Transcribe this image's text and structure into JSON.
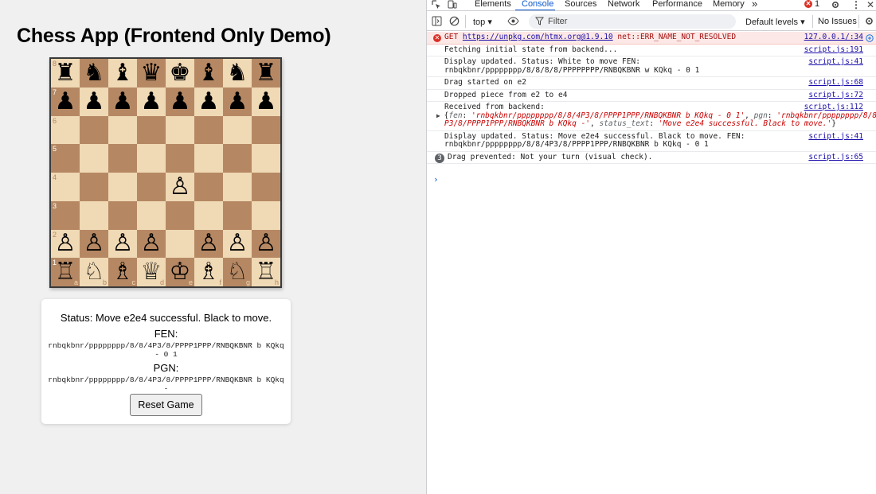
{
  "app": {
    "title": "Chess App (Frontend Only Demo)",
    "board": {
      "ranks": [
        "8",
        "7",
        "6",
        "5",
        "4",
        "3",
        "2",
        "1"
      ],
      "files": [
        "a",
        "b",
        "c",
        "d",
        "e",
        "f",
        "g",
        "h"
      ],
      "rows": [
        [
          "♜",
          "♞",
          "♝",
          "♛",
          "♚",
          "♝",
          "♞",
          "♜"
        ],
        [
          "♟",
          "♟",
          "♟",
          "♟",
          "♟",
          "♟",
          "♟",
          "♟"
        ],
        [
          "",
          "",
          "",
          "",
          "",
          "",
          "",
          ""
        ],
        [
          "",
          "",
          "",
          "",
          "",
          "",
          "",
          ""
        ],
        [
          "",
          "",
          "",
          "",
          "♙",
          "",
          "",
          ""
        ],
        [
          "",
          "",
          "",
          "",
          "",
          "",
          "",
          ""
        ],
        [
          "♙",
          "♙",
          "♙",
          "♙",
          "",
          "♙",
          "♙",
          "♙"
        ],
        [
          "♖",
          "♘",
          "♗",
          "♕",
          "♔",
          "♗",
          "♘",
          "♖"
        ]
      ]
    },
    "info": {
      "status": "Status: Move e2e4 successful. Black to move.",
      "fen_label": "FEN:",
      "fen_value": "rnbqkbnr/pppppppp/8/8/4P3/8/PPPP1PPP/RNBQKBNR b KQkq - 0 1",
      "pgn_label": "PGN:",
      "pgn_value": "rnbqkbnr/pppppppp/8/8/4P3/8/PPPP1PPP/RNBQKBNR b KQkq -",
      "reset_label": "Reset Game"
    }
  },
  "devtools": {
    "tabs": [
      "Elements",
      "Console",
      "Sources",
      "Network",
      "Performance",
      "Memory"
    ],
    "active_tab": "Console",
    "more_tabs": "»",
    "error_count": "1",
    "toolbar": {
      "context": "top ▾",
      "filter_placeholder": "Filter",
      "levels": "Default levels ▾",
      "issues": "No Issues"
    },
    "messages": [
      {
        "type": "error",
        "text": "GET ",
        "link": "https://unpkg.com/htmx.org@1.9.10",
        "after": " net::ERR_NAME_NOT_RESOLVED",
        "source": "127.0.0.1/:34"
      },
      {
        "type": "log",
        "text": "Fetching initial state from backend...",
        "source": "script.js:191"
      },
      {
        "type": "log",
        "text": "Display updated. Status: White to move FEN:\nrnbqkbnr/pppppppp/8/8/8/8/PPPPPPPP/RNBQKBNR w KQkq - 0 1",
        "source": "script.js:41"
      },
      {
        "type": "log",
        "text": "Drag started on e2",
        "source": "script.js:68"
      },
      {
        "type": "log",
        "text": "Dropped piece from e2 to e4",
        "source": "script.js:72"
      },
      {
        "type": "object",
        "text": "Received from backend:",
        "source": "script.js:112",
        "obj_line1_prefix": "{",
        "obj_line1_k1": "fen",
        "obj_line1_v1": "'rnbqkbnr/pppppppp/8/8/4P3/8/PPPP1PPP/RNBQKBNR b KQkq - 0 1'",
        "obj_line1_k2": "pgn",
        "obj_line1_v2": "'rnbqkbnr/pppppppp/8/8/4",
        "obj_line2_v2": "P3/8/PPPP1PPP/RNBQKBNR b KQkq -'",
        "obj_line2_k3": "status_text",
        "obj_line2_v3": "'Move e2e4 successful. Black to move.'",
        "obj_line2_suffix": "}"
      },
      {
        "type": "log",
        "text": "Display updated. Status: Move e2e4 successful. Black to move. FEN:\nrnbqkbnr/pppppppp/8/8/4P3/8/PPPP1PPP/RNBQKBNR b KQkq - 0 1",
        "source": "script.js:41"
      },
      {
        "type": "repeat",
        "count": "3",
        "text": "Drag prevented: Not your turn (visual check).",
        "source": "script.js:65"
      }
    ],
    "prompt": "›"
  }
}
